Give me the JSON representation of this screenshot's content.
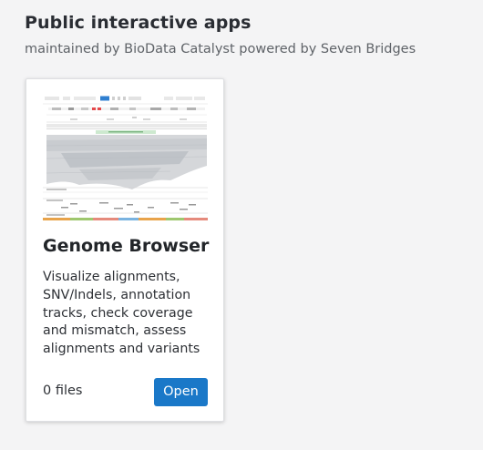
{
  "section": {
    "title": "Public interactive apps",
    "subtitle": "maintained by BioData Catalyst powered by Seven Bridges"
  },
  "apps": [
    {
      "name": "Genome Browser",
      "description": "Visualize alignments, SNV/Indels, annotation tracks, check coverage and mismatch, assess alignments and variants",
      "file_count": "0 files",
      "open_label": "Open",
      "thumbnail_icon": "genome-browser-screenshot",
      "accent_color": "#1a78c8"
    }
  ]
}
